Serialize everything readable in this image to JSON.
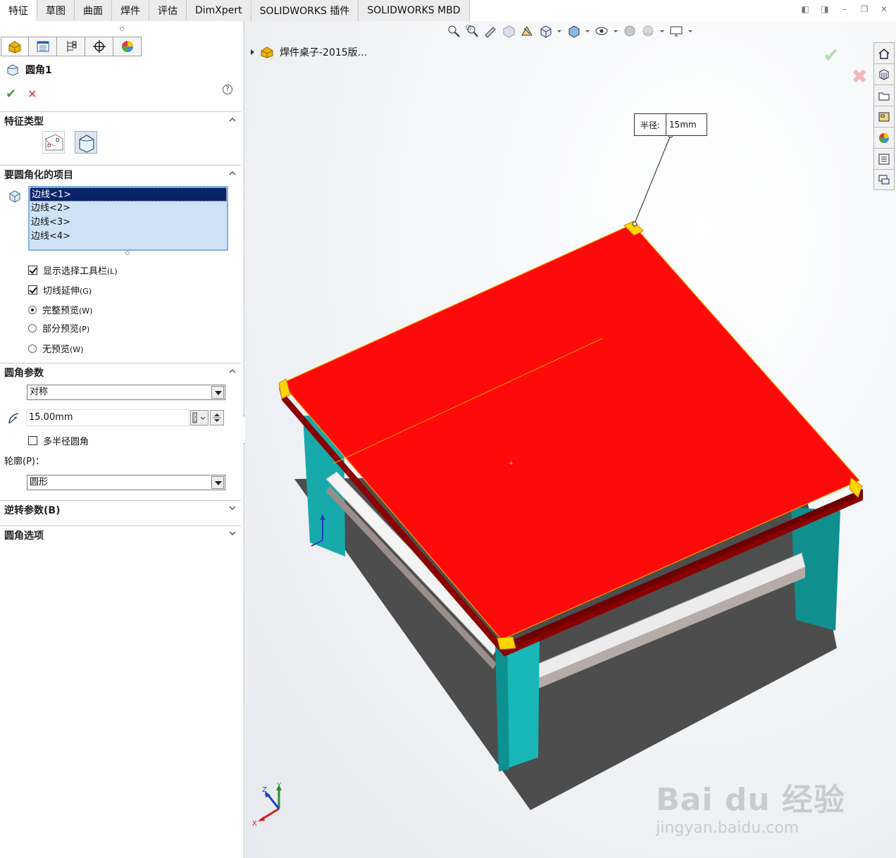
{
  "tabs": [
    {
      "label": "特征"
    },
    {
      "label": "草图"
    },
    {
      "label": "曲面"
    },
    {
      "label": "焊件"
    },
    {
      "label": "评估"
    },
    {
      "label": "DimXpert"
    },
    {
      "label": "SOLIDWORKS 插件"
    },
    {
      "label": "SOLIDWORKS MBD"
    }
  ],
  "property_manager": {
    "title": "圆角1",
    "help": "?",
    "sections": {
      "feature_type": "特征类型",
      "items_to_fillet": "要圆角化的项目",
      "fillet_params": "圆角参数",
      "reverse_params": "逆转参数(B)",
      "fillet_options": "圆角选项"
    },
    "edges": [
      "边线<1>",
      "边线<2>",
      "边线<3>",
      "边线<4>"
    ],
    "options": {
      "show_selection_toolbar": {
        "label": "显示选择工具栏",
        "key": "(L)",
        "checked": true
      },
      "tangent_propagation": {
        "label": "切线延伸",
        "key": "(G)",
        "checked": true
      },
      "full_preview": {
        "label": "完整预览",
        "key": "(W)",
        "selected": true
      },
      "partial_preview": {
        "label": "部分预览",
        "key": "(P)",
        "selected": false
      },
      "no_preview": {
        "label": "无预览",
        "key": "(W)",
        "selected": false
      }
    },
    "fillet_method": "对称",
    "radius_value": "15.00mm",
    "multi_radius": {
      "label": "多半径圆角",
      "checked": false
    },
    "profile_label": "轮廓(P)：",
    "profile_value": "圆形"
  },
  "viewport": {
    "tree_item": "焊件桌子-2015版...",
    "callout": {
      "label": "半径:",
      "value": "15mm"
    }
  },
  "triad": {
    "x": "X",
    "y": "Y",
    "z": "Z"
  },
  "watermark": {
    "line1": "Bai du 经验",
    "line2": "jingyan.baidu.com"
  },
  "colors": {
    "top_face": "#ff0a0a",
    "legs": "#19b7b7",
    "highlight": "#ffd400",
    "listbox_selected": "#0a246a"
  }
}
